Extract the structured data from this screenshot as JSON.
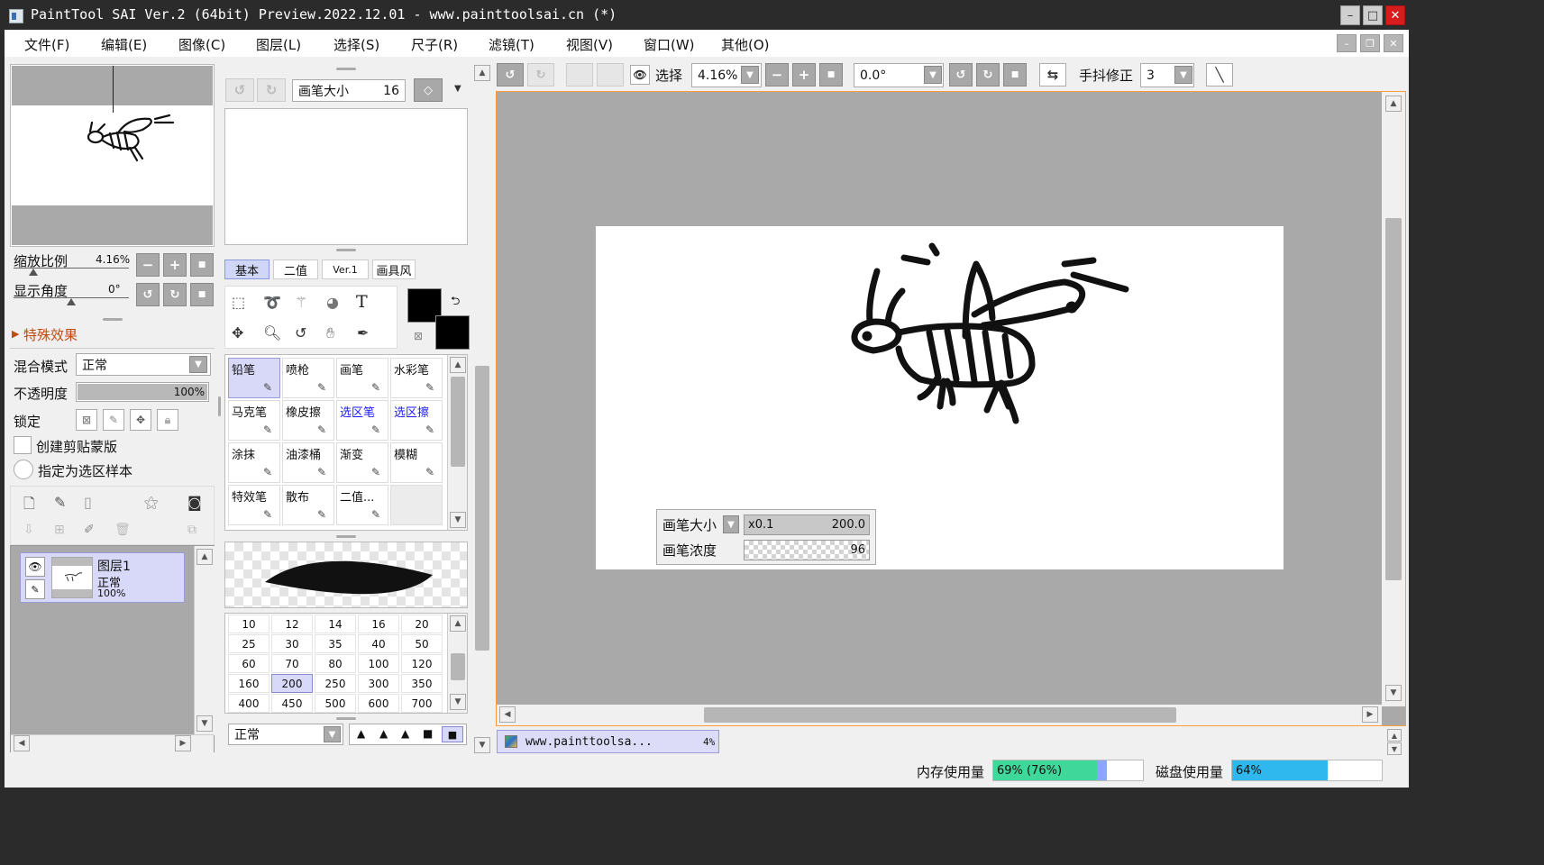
{
  "window": {
    "title": "PaintTool SAI Ver.2 (64bit) Preview.2022.12.01 - www.painttoolsai.cn (*)",
    "minimize": "–",
    "maximize": "□",
    "close": "✕"
  },
  "menu": [
    "文件(F)",
    "编辑(E)",
    "图像(C)",
    "图层(L)",
    "选择(S)",
    "尺子(R)",
    "滤镜(T)",
    "视图(V)",
    "窗口(W)",
    "其他(O)"
  ],
  "navigator": {
    "zoom_label": "缩放比例",
    "zoom_value": "4.16%",
    "angle_label": "显示角度",
    "angle_value": "0°"
  },
  "effects": {
    "label": "特殊效果"
  },
  "layer_props": {
    "blend_label": "混合模式",
    "blend_value": "正常",
    "opacity_label": "不透明度",
    "opacity_value": "100%",
    "opacity_fraction": 1.0,
    "lock_label": "锁定",
    "clip_label": "创建剪贴蒙版",
    "sample_label": "指定为选区样本"
  },
  "layers": [
    {
      "name": "图层1",
      "mode": "正常",
      "opacity": "100%"
    }
  ],
  "brush_header": {
    "label": "画笔大小",
    "value": "16"
  },
  "tool_tabs": [
    "基本",
    "二值",
    "Ver.1",
    "画具风"
  ],
  "tool_tab_selected": 0,
  "tools": [
    {
      "label": "铅笔",
      "selected": true,
      "color": "#111111",
      "icon": "pencil-icon"
    },
    {
      "label": "喷枪",
      "selected": false,
      "color": "#111111",
      "icon": "airbrush-icon"
    },
    {
      "label": "画笔",
      "selected": false,
      "color": "#111111",
      "icon": "brush-icon"
    },
    {
      "label": "水彩笔",
      "selected": false,
      "color": "#111111",
      "icon": "watercolor-icon"
    },
    {
      "label": "马克笔",
      "selected": false,
      "color": "#111111",
      "icon": "marker-icon"
    },
    {
      "label": "橡皮擦",
      "selected": false,
      "color": "#111111",
      "icon": "eraser-icon"
    },
    {
      "label": "选区笔",
      "selected": false,
      "color": "#1a1aff",
      "icon": "select-pen-icon"
    },
    {
      "label": "选区擦",
      "selected": false,
      "color": "#1a1aff",
      "icon": "select-eraser-icon"
    },
    {
      "label": "涂抹",
      "selected": false,
      "color": "#111111",
      "icon": "blur-icon"
    },
    {
      "label": "油漆桶",
      "selected": false,
      "color": "#111111",
      "icon": "bucket-icon"
    },
    {
      "label": "渐变",
      "selected": false,
      "color": "#111111",
      "icon": "gradient-icon"
    },
    {
      "label": "模糊",
      "selected": false,
      "color": "#111111",
      "icon": "drop-icon"
    },
    {
      "label": "特效笔",
      "selected": false,
      "color": "#111111",
      "icon": "fx-pen-icon"
    },
    {
      "label": "散布",
      "selected": false,
      "color": "#111111",
      "icon": "scatter-icon"
    },
    {
      "label": "二值...",
      "selected": false,
      "color": "#111111",
      "icon": "binary-icon"
    },
    {
      "label": "",
      "selected": false,
      "color": "#111111",
      "icon": ""
    }
  ],
  "brush_sizes": [
    "10",
    "12",
    "14",
    "16",
    "20",
    "25",
    "30",
    "35",
    "40",
    "50",
    "60",
    "70",
    "80",
    "100",
    "120",
    "160",
    "200",
    "250",
    "300",
    "350",
    "400",
    "450",
    "500",
    "600",
    "700"
  ],
  "brush_size_selected": "200",
  "brush_blend": "正常",
  "toolbar": {
    "select_label": "选择",
    "zoom_value": "4.16%",
    "angle_value": "0.0°",
    "stabilizer_label": "手抖修正",
    "stabilizer_value": "3"
  },
  "brush_popup": {
    "size_label": "画笔大小",
    "size_multiplier": "x0.1",
    "size_value": "200.0",
    "density_label": "画笔浓度",
    "density_value": "96"
  },
  "doc_tab": {
    "name": "www.painttoolsa...",
    "zoom": "4%"
  },
  "status": {
    "memory_label": "内存使用量",
    "memory_value": "69% (76%)",
    "memory_fraction": 0.69,
    "memory_fraction_2": 0.76,
    "disk_label": "磁盘使用量",
    "disk_value": "64%",
    "disk_fraction": 0.64
  },
  "colors": {
    "accent_selected": "#d8d8f8",
    "memory_bar": "#3fd89a",
    "memory_bar_2": "#8aa7ff",
    "disk_bar": "#2fb8ee",
    "canvas_border": "#ff9b3c",
    "canvas_bg": "#a9a9a9"
  }
}
